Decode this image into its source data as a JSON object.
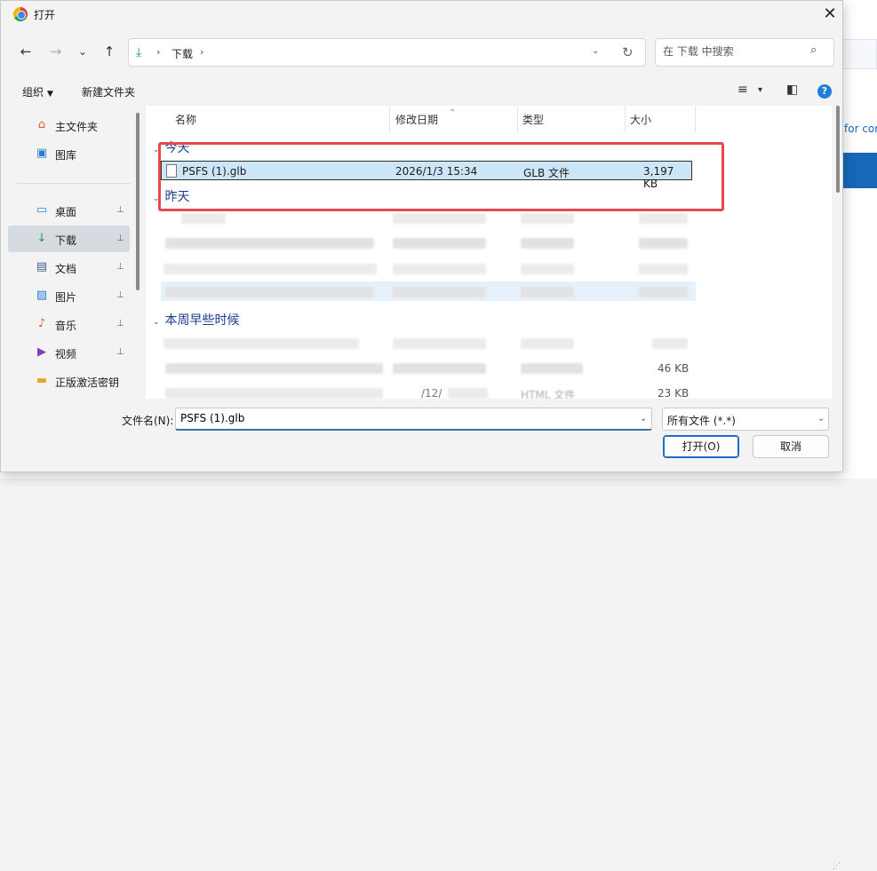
{
  "background": {
    "link_text": "for con"
  },
  "titlebar": {
    "title": "打开",
    "close_glyph": "✕"
  },
  "nav": {
    "back": "←",
    "forward": "→",
    "recent": "⌄",
    "up": "↑"
  },
  "address": {
    "location": "下载",
    "sep": "›",
    "dropdown": "⌄",
    "refresh": "↻"
  },
  "search": {
    "placeholder": "在 下载 中搜索",
    "icon": "⌕"
  },
  "commandbar": {
    "organize": "组织",
    "new_folder": "新建文件夹",
    "view_icon": "≡",
    "view_caret": "▾",
    "pane_icon": "◧",
    "help": "?"
  },
  "navpane": {
    "items": [
      {
        "label": "主文件夹",
        "icon": "⌂",
        "pinned": false
      },
      {
        "label": "图库",
        "icon": "▣",
        "pinned": false
      },
      {
        "label": "桌面",
        "icon": "▭",
        "pinned": true
      },
      {
        "label": "下载",
        "icon": "↓",
        "pinned": true,
        "selected": true
      },
      {
        "label": "文档",
        "icon": "▤",
        "pinned": true
      },
      {
        "label": "图片",
        "icon": "▨",
        "pinned": true
      },
      {
        "label": "音乐",
        "icon": "♪",
        "pinned": true
      },
      {
        "label": "视频",
        "icon": "▶",
        "pinned": true
      },
      {
        "label": "正版激活密钥",
        "icon": "▬",
        "pinned": false
      }
    ],
    "pin_glyph": "📌"
  },
  "columns": {
    "name": "名称",
    "modified": "修改日期",
    "type": "类型",
    "size": "大小",
    "sort_glyph": "⌃"
  },
  "groups": {
    "today": "今天",
    "yesterday": "昨天",
    "this_week": "本周早些时候",
    "chevron": "⌄"
  },
  "files": [
    {
      "name": "PSFS (1).glb",
      "modified": "2026/1/3 15:34",
      "type": "GLB 文件",
      "size": "3,197 KB"
    }
  ],
  "partial": {
    "size1": "46 KB",
    "size2": "23 KB",
    "date_frag": "/12/",
    "type_frag": "HTML 文件"
  },
  "bottom": {
    "filename_label": "文件名(N):",
    "filename_value": "PSFS (1).glb",
    "filetype": "所有文件 (*.*)",
    "open_button": "打开(O)",
    "cancel_button": "取消",
    "dropdown": "⌄"
  },
  "colors": {
    "accent": "#1e6cc4",
    "highlight_box": "#e8484a",
    "selection": "#cde6f7",
    "group_text": "#1b3d8f"
  }
}
